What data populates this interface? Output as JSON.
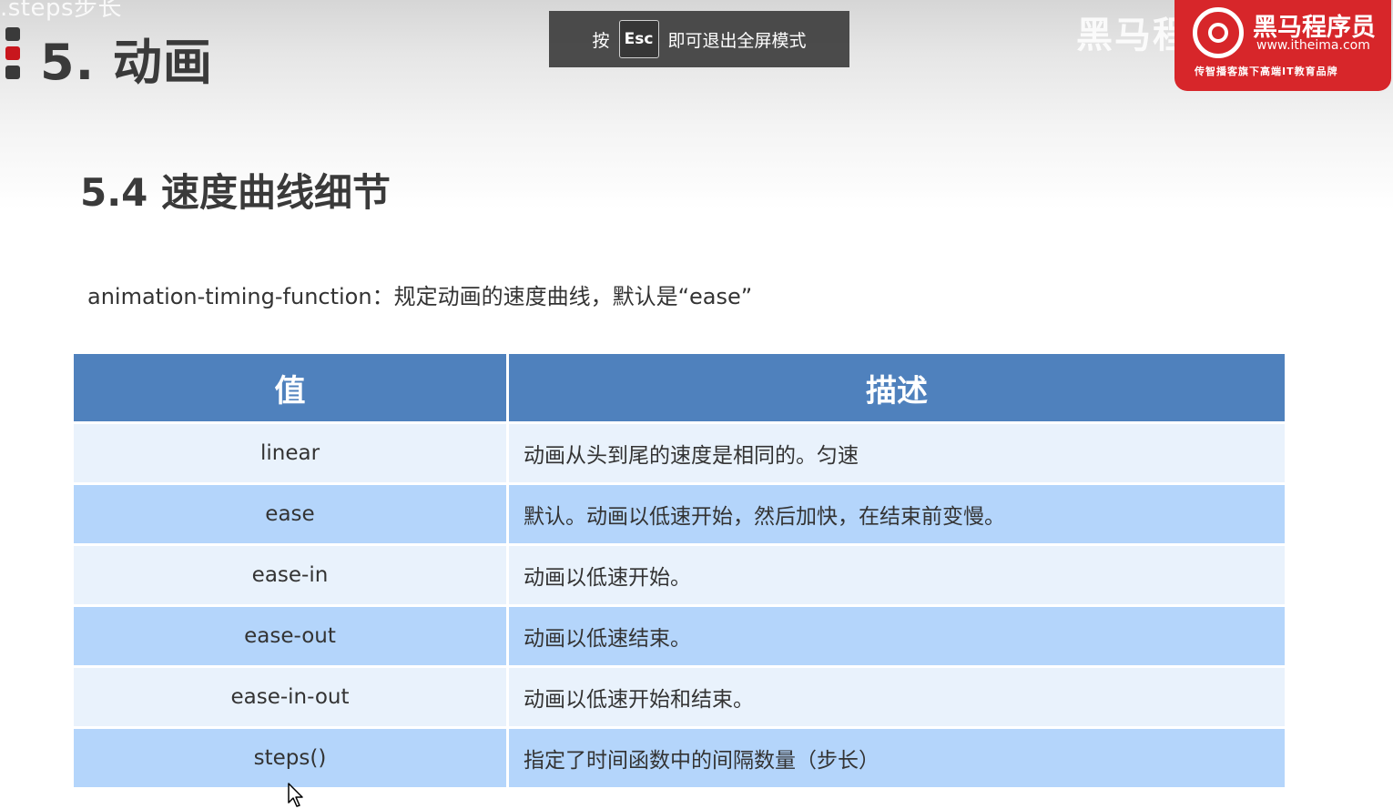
{
  "slide": {
    "top_fragment": ".steps步长",
    "chapter_title": "5. 动画",
    "section_title": "5.4 速度曲线细节",
    "description": "animation-timing-function：规定动画的速度曲线，默认是“ease”"
  },
  "fullscreen_notice": {
    "prefix": "按",
    "key": "Esc",
    "suffix": "即可退出全屏模式"
  },
  "watermark": {
    "text": "黑马程序员",
    "brand_name": "黑马程序员",
    "url": "www.itheima.com",
    "slogan": "传智播客旗下高端IT教育品牌"
  },
  "table": {
    "headers": [
      "值",
      "描述"
    ],
    "rows": [
      {
        "value": "linear",
        "description": "动画从头到尾的速度是相同的。匀速"
      },
      {
        "value": "ease",
        "description": "默认。动画以低速开始，然后加快，在结束前变慢。"
      },
      {
        "value": "ease-in",
        "description": "动画以低速开始。"
      },
      {
        "value": "ease-out",
        "description": "动画以低速结束。"
      },
      {
        "value": "ease-in-out",
        "description": "动画以低速开始和结束。"
      },
      {
        "value": "steps()",
        "description": "指定了时间函数中的间隔数量（步长）"
      }
    ]
  },
  "colors": {
    "header_bg": "#4f81bd",
    "row_light": "#e9f2fc",
    "row_dark": "#b4d5fb",
    "brand_red": "#d7262a",
    "marker_red": "#c8161d"
  },
  "icons": {
    "cursor": "mouse-pointer-icon",
    "brand_logo": "itheima-logo-icon"
  }
}
